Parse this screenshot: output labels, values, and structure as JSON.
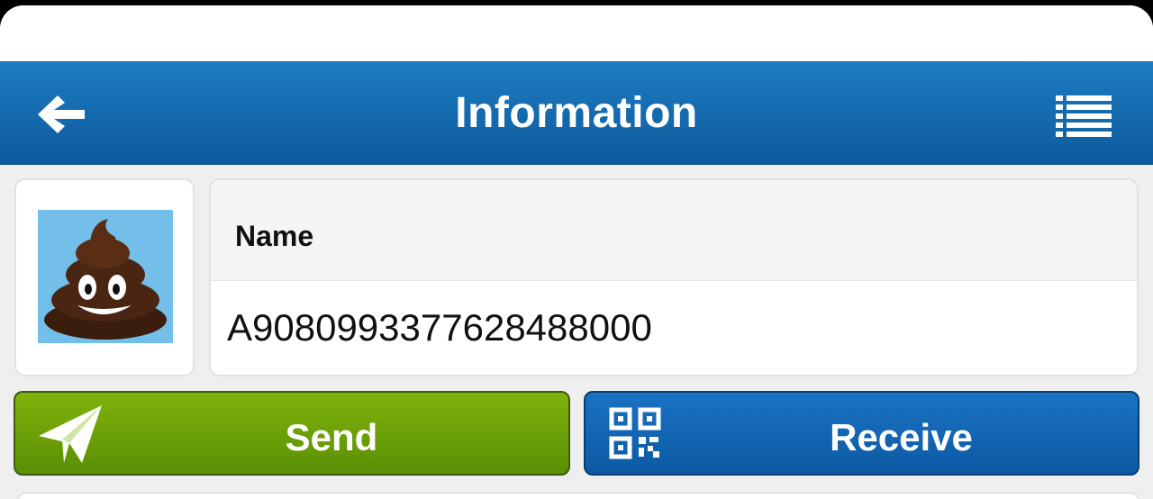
{
  "header": {
    "title": "Information",
    "back_icon": "arrow-left-icon",
    "menu_icon": "list-menu-icon"
  },
  "profile": {
    "avatar_icon": "poop-emoji-avatar",
    "name_label": "Name",
    "name_value": "A9080993377628488000"
  },
  "actions": {
    "send_label": "Send",
    "send_icon": "paper-plane-icon",
    "receive_label": "Receive",
    "receive_icon": "qr-code-icon"
  },
  "colors": {
    "navbar": "#1565a8",
    "send": "#6fa208",
    "receive": "#1266b5"
  }
}
